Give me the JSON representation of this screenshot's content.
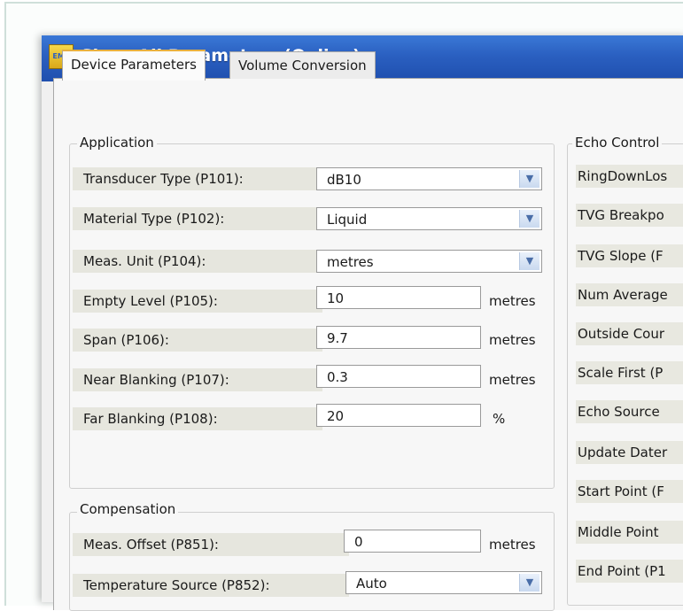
{
  "window": {
    "title": "Show All Parameters (Online)",
    "icon": "app-icon"
  },
  "tabs": [
    {
      "label": "Device Parameters",
      "active": true
    },
    {
      "label": "Volume Conversion",
      "active": false
    }
  ],
  "application": {
    "legend": "Application",
    "rows": [
      {
        "label": "Transducer Type (P101):",
        "value": "dB10",
        "kind": "combo"
      },
      {
        "label": "Material Type (P102):",
        "value": "Liquid",
        "kind": "combo"
      },
      {
        "label": "Meas. Unit (P104):",
        "value": "metres",
        "kind": "combo"
      },
      {
        "label": "Empty Level (P105):",
        "value": "10",
        "unit": "metres",
        "kind": "text"
      },
      {
        "label": "Span (P106):",
        "value": "9.7",
        "unit": "metres",
        "kind": "text"
      },
      {
        "label": "Near Blanking (P107):",
        "value": "0.3",
        "unit": "metres",
        "kind": "text"
      },
      {
        "label": "Far Blanking (P108):",
        "value": "20",
        "unit": "%",
        "kind": "text"
      }
    ]
  },
  "compensation": {
    "legend": "Compensation",
    "rows": [
      {
        "label": "Meas. Offset (P851):",
        "value": "0",
        "unit": "metres",
        "kind": "text"
      },
      {
        "label": "Temperature Source (P852):",
        "value": "Auto",
        "kind": "combo"
      }
    ]
  },
  "echo_control": {
    "legend": "Echo Control",
    "rows": [
      "RingDownLos",
      "TVG Breakpo",
      "TVG Slope (F",
      "Num Average",
      "Outside Cour",
      "Scale First (P",
      "Echo Source",
      "Update Dater",
      "Start Point (F",
      "Middle Point",
      "End Point (P1"
    ]
  },
  "colors": {
    "titlebar": "#2a5fc0",
    "label_bg": "#e6e6de",
    "active_tab_accent": "#e8b040"
  }
}
